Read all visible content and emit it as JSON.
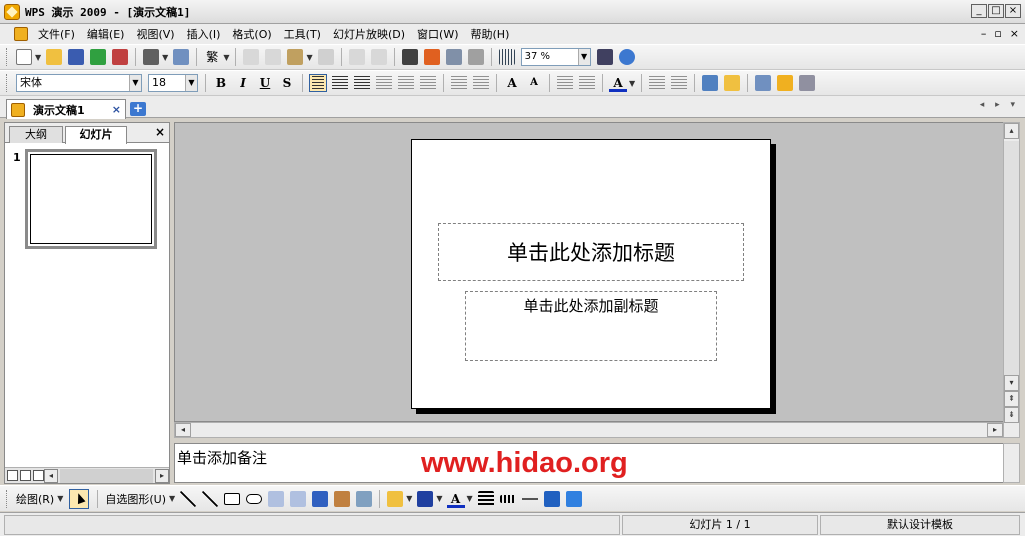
{
  "window": {
    "title": "WPS 演示 2009 - [演示文稿1]",
    "controls": [
      "_",
      "□",
      "×"
    ]
  },
  "menu": {
    "items": [
      "文件(F)",
      "编辑(E)",
      "视图(V)",
      "插入(I)",
      "格式(O)",
      "工具(T)",
      "幻灯片放映(D)",
      "窗口(W)",
      "帮助(H)"
    ],
    "right_controls": [
      "×",
      "🗗",
      "×"
    ]
  },
  "toolbar": {
    "zoom": "37 %",
    "font_name": "宋体",
    "font_size": "18",
    "bold": "B",
    "italic": "I",
    "underline": "U",
    "shadow": "S",
    "char_label": "繁",
    "font_grow": "A",
    "font_color": "A"
  },
  "tabs": {
    "doc_tab": "演示文稿1",
    "close": "×",
    "new": "+"
  },
  "left_pane": {
    "tab_outline": "大纲",
    "tab_slides": "幻灯片",
    "close": "×",
    "slide_number": "1"
  },
  "slide": {
    "title_placeholder": "单击此处添加标题",
    "subtitle_placeholder": "单击此处添加副标题"
  },
  "notes": {
    "placeholder": "单击添加备注",
    "watermark": "www.hidao.org"
  },
  "drawing_toolbar": {
    "draw_label": "绘图(R)",
    "autoshape_label": "自选图形(U)"
  },
  "status": {
    "slide_info": "幻灯片 1 / 1",
    "template": "默认设计模板"
  },
  "colors": {
    "accent": "#3c78d0",
    "watermark": "#e02020",
    "canvas_bg": "#c0c0c0"
  }
}
